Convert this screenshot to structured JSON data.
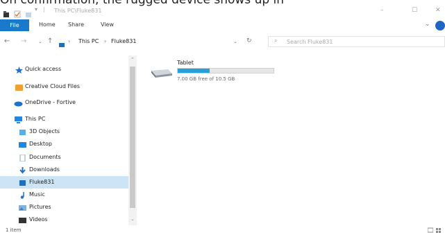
{
  "caption": "On confirmation, the rugged device shows up in",
  "window": {
    "title": "This PC\\Fluke831",
    "controls": {
      "minimize": "–",
      "maximize": "☐",
      "close": "✕"
    }
  },
  "ribbon": {
    "tabs": [
      "File",
      "Home",
      "Share",
      "View"
    ]
  },
  "address": {
    "crumbs": [
      "This PC",
      "Fluke831"
    ],
    "search_placeholder": "Search Fluke831"
  },
  "sidebar": {
    "items": [
      {
        "label": "Quick access",
        "icon": "star-icon"
      },
      {
        "label": "Creative Cloud Files",
        "icon": "creative-cloud-icon"
      },
      {
        "label": "OneDrive - Fortive",
        "icon": "cloud-icon"
      },
      {
        "label": "This PC",
        "icon": "computer-icon"
      },
      {
        "label": "3D Objects",
        "icon": "cube-icon"
      },
      {
        "label": "Desktop",
        "icon": "desktop-folder-icon"
      },
      {
        "label": "Documents",
        "icon": "documents-icon"
      },
      {
        "label": "Downloads",
        "icon": "download-icon"
      },
      {
        "label": "Fluke831",
        "icon": "device-icon",
        "selected": true
      },
      {
        "label": "Music",
        "icon": "music-icon"
      },
      {
        "label": "Pictures",
        "icon": "pictures-icon"
      },
      {
        "label": "Videos",
        "icon": "videos-icon"
      }
    ]
  },
  "content": {
    "drive": {
      "name": "Tablet",
      "free_text": "7.00 GB free of 10.5 GB",
      "used_fraction": 0.333
    }
  },
  "status": {
    "count": "1 item"
  },
  "colors": {
    "accent": "#1979ca",
    "selection": "#cde4f6",
    "bar": "#26a0da"
  }
}
